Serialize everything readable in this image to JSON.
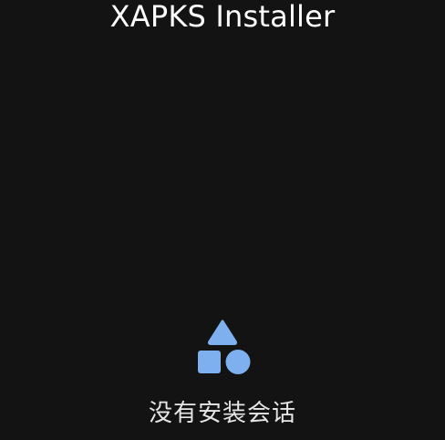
{
  "app": {
    "title": "XAPKS Installer"
  },
  "empty_state": {
    "icon": "shapes-icon",
    "message": "没有安装会话"
  },
  "colors": {
    "background": "#131313",
    "accent": "#7eb0f0",
    "text": "#e6e6e6"
  }
}
